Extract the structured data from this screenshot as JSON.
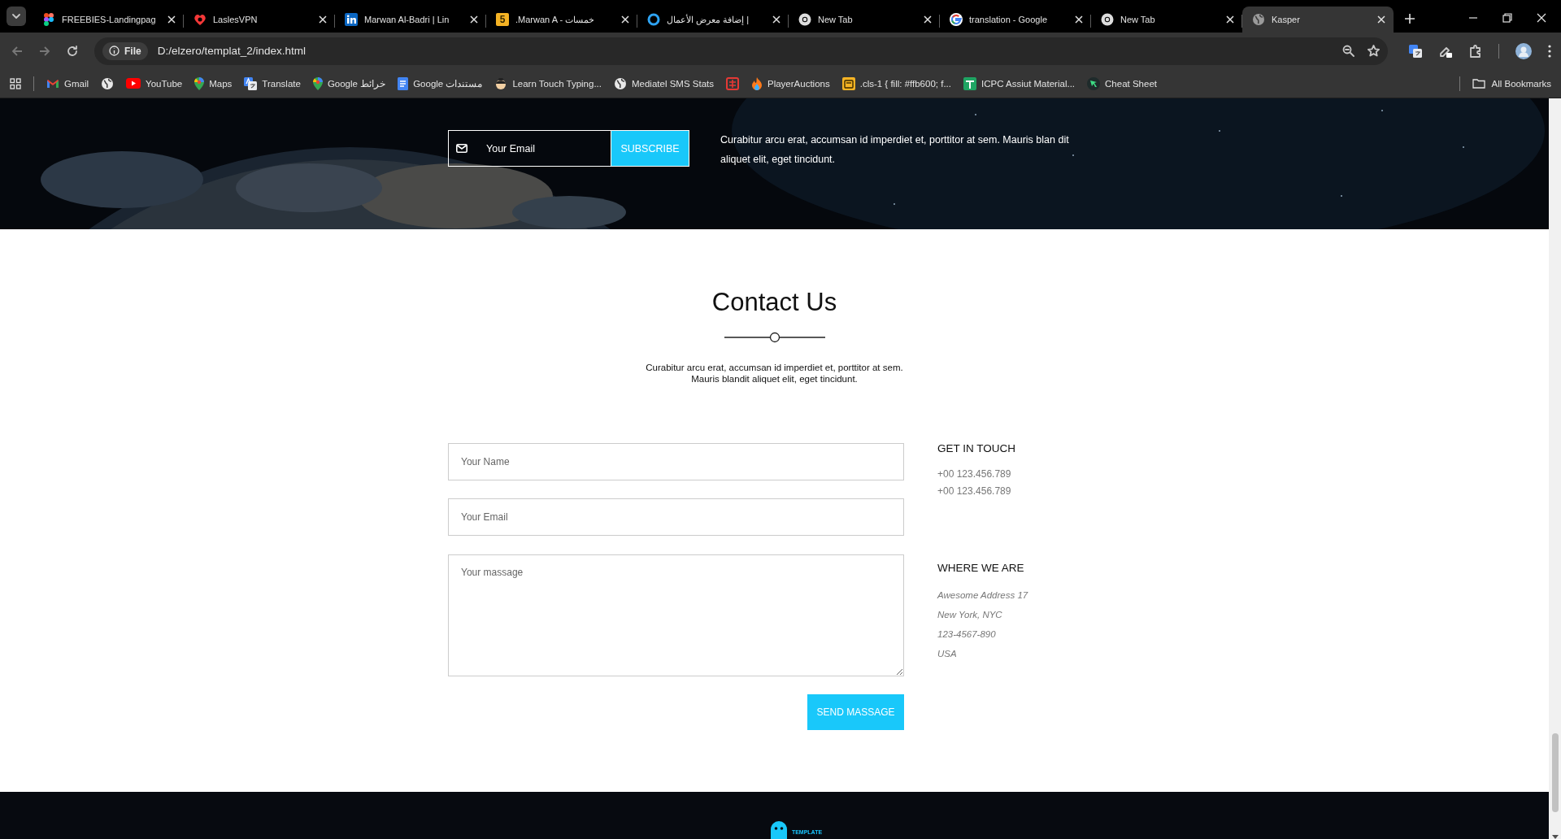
{
  "browser": {
    "tabs": [
      {
        "title": "FREEBIES-Landingpag",
        "kind": "figma",
        "selected": false
      },
      {
        "title": "LaslesVPN",
        "kind": "vpn",
        "selected": false
      },
      {
        "title": "Marwan Al-Badri | Lin",
        "kind": "linkedin",
        "selected": false
      },
      {
        "title": ".Marwan A - خمسات",
        "kind": "khamsat",
        "icon_text": "5",
        "selected": false
      },
      {
        "title": "إضافة معرض الأعمال |",
        "kind": "ring",
        "selected": false
      },
      {
        "title": "New Tab",
        "kind": "chrome",
        "selected": false
      },
      {
        "title": "translation - Google",
        "kind": "google",
        "selected": false
      },
      {
        "title": "New Tab",
        "kind": "chrome",
        "selected": false
      },
      {
        "title": "Kasper",
        "kind": "globe",
        "selected": true
      }
    ],
    "url_chip": "File",
    "url": "D:/elzero/templat_2/index.html",
    "bookmarks": [
      {
        "label": "Gmail",
        "kind": "gmail"
      },
      {
        "kind": "globe"
      },
      {
        "label": "YouTube",
        "kind": "youtube"
      },
      {
        "label": "Maps",
        "kind": "maps"
      },
      {
        "label": "Translate",
        "kind": "translate"
      },
      {
        "label": "Google خرائط",
        "kind": "maps"
      },
      {
        "label": "Google مستندات",
        "kind": "docs"
      },
      {
        "label": "Learn Touch Typing...",
        "kind": "face"
      },
      {
        "label": "Mediatel SMS Stats",
        "kind": "globe"
      },
      {
        "kind": "redbox"
      },
      {
        "label": "PlayerAuctions",
        "kind": "flame"
      },
      {
        "label": ".cls-1 { fill: #ffb600; f...",
        "kind": "yellowbox"
      },
      {
        "label": "ICPC Assiut Material...",
        "kind": "sheets"
      },
      {
        "label": "Cheat Sheet",
        "kind": "dart"
      }
    ],
    "all_bookmarks": "All Bookmarks"
  },
  "subscribe": {
    "placeholder": "Your Email",
    "button": "SUBSCRIBE",
    "text": "Curabitur arcu erat, accumsan id imperdiet et, porttitor at sem. Mauris blan dit aliquet elit, eget tincidunt."
  },
  "contact": {
    "title": "Contact Us",
    "text_lines": [
      "Curabitur arcu erat, accumsan id imperdiet et, porttitor at sem.",
      "Mauris blandit aliquet elit, eget tincidunt."
    ],
    "fields": [
      {
        "kind": "input",
        "placeholder": "Your Name"
      },
      {
        "kind": "input",
        "placeholder": "Your Email"
      },
      {
        "kind": "textarea",
        "placeholder": "Your massage"
      }
    ],
    "button": "SEND MASSAGE",
    "info": [
      {
        "kind": "phones",
        "heading": "GET IN TOUCH",
        "lines": [
          "+00 123.456.789",
          "+00 123.456.789"
        ]
      },
      {
        "kind": "address",
        "heading": "WHERE WE ARE",
        "lines": [
          "Awesome Address 17",
          "New York, NYC",
          "123-4567-890",
          "USA"
        ]
      }
    ]
  },
  "footer": {
    "logo_tag": "TEMPLATE"
  }
}
